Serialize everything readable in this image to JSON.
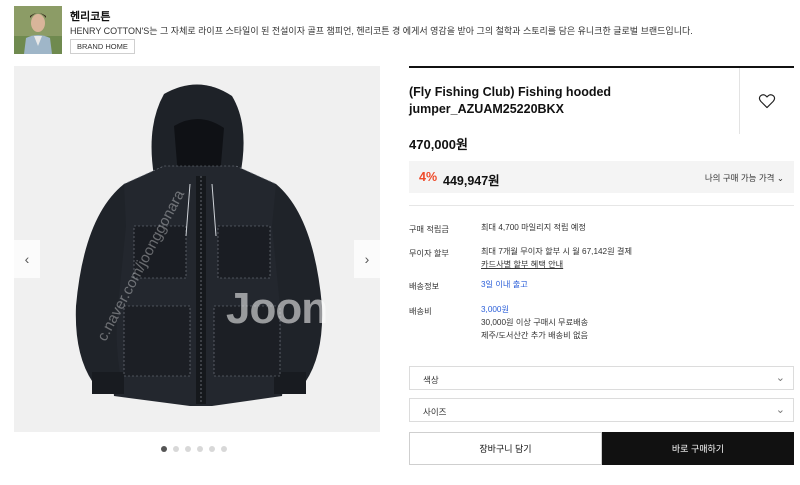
{
  "brand": {
    "name": "헨리코튼",
    "description": "HENRY COTTON'S는 그 자체로 라이프 스타일이 된 전설이자 골프 챔피언, 헨리코튼 경 에게서 영감을 받아 그의 철학과 스토리를 담은 유니크한 글로벌 브랜드입니다.",
    "home_button": "BRAND HOME"
  },
  "gallery": {
    "watermark": "Joon",
    "watermark_diag": "c.naver.com/joonggonara",
    "prev_icon": "chevron-left-icon",
    "next_icon": "chevron-right-icon",
    "dot_count": 6,
    "active_dot": 0
  },
  "product": {
    "title": "(Fly Fishing Club) Fishing hooded jumper_AZUAM25220BKX",
    "price": "470,000원",
    "discount_percent": "4%",
    "discount_price": "449,947원",
    "my_price_link": "나의 구매 가능 가격"
  },
  "info": {
    "points_label": "구매 적립금",
    "points_value": "최대 4,700 마일리지 적립 예정",
    "installment_label": "무이자 할부",
    "installment_value": "최대 7개월 무이자 할부 시 월 67,142원 결제",
    "installment_link": "카드사별 할부 혜택 안내",
    "shipping_info_label": "배송정보",
    "shipping_info_value": "3일 이내 출고",
    "shipping_fee_label": "배송비",
    "shipping_fee_value": "3,000원",
    "shipping_free_note": "30,000원 이상 구매시 무료배송",
    "shipping_island_note": "제주/도서산간 추가 배송비 없음"
  },
  "options": {
    "color_placeholder": "색상",
    "size_placeholder": "사이즈"
  },
  "actions": {
    "cart": "장바구니 담기",
    "buy": "바로 구매하기"
  },
  "colors": {
    "accent_red": "#ef4b2a",
    "link_blue": "#2b5fd9",
    "buy_button": "#111111"
  }
}
